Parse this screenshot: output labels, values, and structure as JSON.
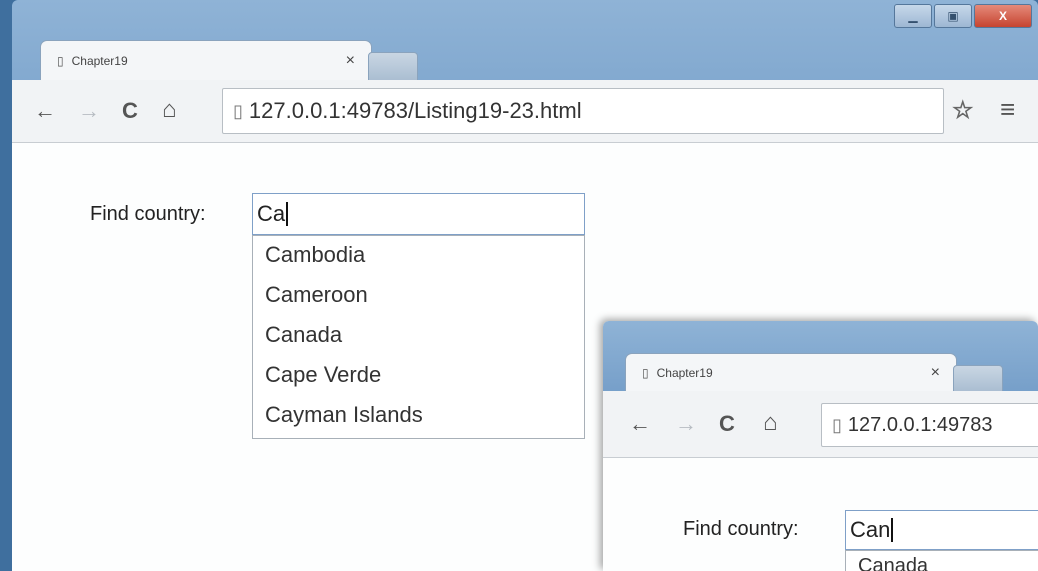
{
  "window_main": {
    "tab_title": "Chapter19",
    "tab_close": "×",
    "url": "127.0.0.1:49783/Listing19-23.html",
    "controls": {
      "minimize_glyph": "▁",
      "restore_glyph": "▣",
      "close_glyph": "X"
    },
    "page": {
      "label": "Find country:",
      "input_value": "Ca",
      "suggestions": [
        "Cambodia",
        "Cameroon",
        "Canada",
        "Cape Verde",
        "Cayman Islands"
      ]
    }
  },
  "window_overlay": {
    "tab_title": "Chapter19",
    "tab_close": "×",
    "url": "127.0.0.1:49783",
    "page": {
      "label": "Find country:",
      "input_value": "Can",
      "suggestions": [
        "Canada"
      ]
    }
  },
  "icons": {
    "back": "←",
    "forward": "→",
    "reload": "C",
    "home": "⌂",
    "page": "▯",
    "star": "☆",
    "menu": "≡"
  },
  "colors": {
    "frame": "#6c97c4",
    "toolbar": "#f1f3f5",
    "input_border": "#7fa0c8"
  }
}
